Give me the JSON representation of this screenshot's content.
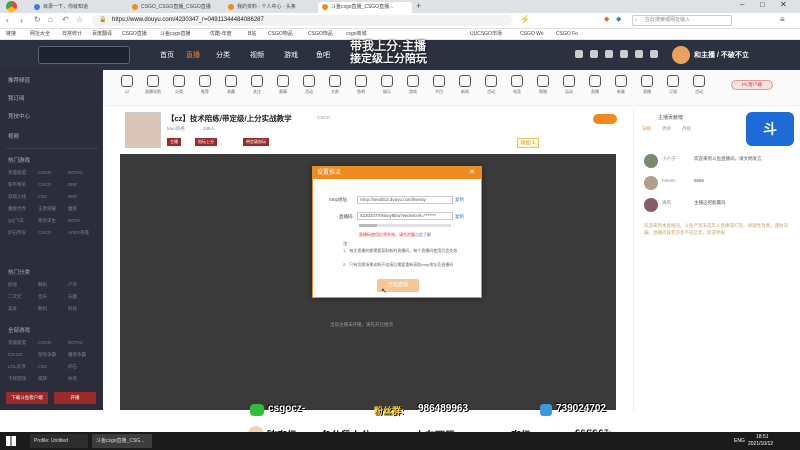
{
  "browser": {
    "tabs": [
      {
        "label": "目录一下，你就知道",
        "color": "#3b7ddd"
      },
      {
        "label": "CSGO_CSGO直播_CSGO直播",
        "color": "#f08a1e"
      },
      {
        "label": "我的资料 - 个人中心 - 头条",
        "color": "#f08a1e"
      },
      {
        "label": "斗鱼csgo直播_CSGO直播...",
        "color": "#f08a1e"
      }
    ],
    "active_tab_index": 3,
    "url": "https://www.douyu.com/4230347_r=04911344484086287",
    "search_placeholder": "在此搜索或网址输入",
    "bookmarks": [
      "链接",
      "网址大全",
      "日常统计",
      "百度翻译",
      "CSGO直播",
      "斗鱼csgo直播",
      "优酷-年度",
      "B站",
      "CSGO物品",
      "CSGO饰品",
      "csgo商城",
      "UUCSGO市场",
      "CSGO Wo",
      "CSGO Fo"
    ]
  },
  "site": {
    "nav": [
      "首页",
      "直播",
      "分类",
      "视频",
      "游戏",
      "鱼吧"
    ],
    "banner": {
      "line1": "带我上分·主播",
      "line2": "接定级上分陪玩"
    },
    "banner_right": "和主播 / 不破不立"
  },
  "leftnav": {
    "sections": [
      "推荐频道",
      "我订阅",
      "竞技中心",
      "视频"
    ],
    "group1_title": "热门游戏",
    "group1_items": [
      [
        "英雄联盟",
        "CSGO",
        "DOTA2"
      ],
      [
        "和平精英",
        "CSGO",
        "DNF"
      ],
      [
        "穿越火线",
        "CS2",
        "DNF"
      ],
      [
        "魔兽世界",
        "王者荣耀",
        "魔兽"
      ],
      [
        "QQ飞车",
        "绝地求生",
        "DOTA"
      ],
      [
        "炉石传说",
        "CSGO",
        "APEX英雄"
      ]
    ],
    "group2_title": "热门分类",
    "group2_items": [
      [
        "颜值",
        "舞蹈",
        "户外"
      ],
      [
        "二次元",
        "音乐",
        "乐趣"
      ],
      [
        "美食",
        "数码",
        "科技"
      ]
    ],
    "group3_title": "全部游戏",
    "group3_items": [
      [
        "英雄联盟",
        "CSGO",
        "DOTA2"
      ],
      [
        "CS:GO",
        "星际争霸",
        "魔兽争霸"
      ],
      [
        "LOL云顶",
        "CS2",
        "炉石"
      ],
      [
        "卡牌游戏",
        "棋牌",
        "体育"
      ]
    ],
    "bottom_buttons": [
      "下载斗鱼客户端",
      "开播"
    ]
  },
  "categories": [
    "12",
    "直播导航",
    "分类",
    "推荐",
    "收藏",
    "关注",
    "赛事",
    "活动",
    "大龄",
    "鱼吧",
    "娱乐",
    "游戏",
    "节目",
    "新闻",
    "活动",
    "电竞",
    "购物",
    "运动",
    "直播",
    "新春",
    "直播",
    "订阅",
    "活动"
  ],
  "cat_badge": "PC客户端",
  "room": {
    "title": "【cz】技术陪练/带定级/上分实战教学",
    "category": "CSGO",
    "uploader": "Muu风格",
    "viewers": "345人",
    "tags": [
      "主播",
      "陪玩上分",
      "带定级陪玩"
    ],
    "level_badge": "段位: 1",
    "streamer_note": "当前主播未开播，请先开启推流",
    "right_panel_title": "主播贡献榜",
    "rank_tabs": [
      "日榜",
      "周榜",
      "月榜"
    ]
  },
  "dialog": {
    "title": "设置推流",
    "close_glyph": "✕",
    "rtmp_label": "rtmp地址:",
    "rtmp_value": "rtmp://sendtc3.douyu.com/live/ay",
    "rtmp_copy": "复制",
    "key_label": "直播码:",
    "key_value": "4230347rhNxuy8Ew?wsSecret=*******",
    "key_copy": "复制",
    "key_hint": "直播码使用后将失效，请勿泄露",
    "key_hint_link": "点此了解",
    "notes_title": "注:",
    "notes": [
      "1、每次直播前都需要获取新的直播码，每个直播码使用后会失效",
      "2、只有切换场景或断开连接后需要重新获取rtmp地址及直播码"
    ],
    "start_button": "开始直播"
  },
  "chat": {
    "messages": [
      {
        "user": "小六子",
        "text": "欢迎来到斗鱼直播间，请文明发言"
      },
      {
        "user": "hmmm",
        "text": "6666"
      },
      {
        "user": "清风",
        "text": "主播这把能赢吗"
      },
      {
        "user": "系统",
        "text": "欢迎来到本直播间，斗鱼严禁未成年人直播或打赏。请理性消费，谨防诈骗。直播内容若涉及不良信息，欢迎举报"
      }
    ]
  },
  "overlay": {
    "contact_wechat": "csgocz-",
    "contact_fans_label": "粉丝群:",
    "contact_fans": "986489963",
    "contact_qq": "739024702",
    "footer": [
      "陪定级",
      "各分段上分",
      "上车两周",
      "定级",
      "csgocz"
    ]
  },
  "taskbar": {
    "apps": [
      "Profile: Untitled",
      "斗鱼csgo直播_CSG..."
    ],
    "lang": "ENG",
    "time": "18:51",
    "date": "2021/10/12"
  }
}
